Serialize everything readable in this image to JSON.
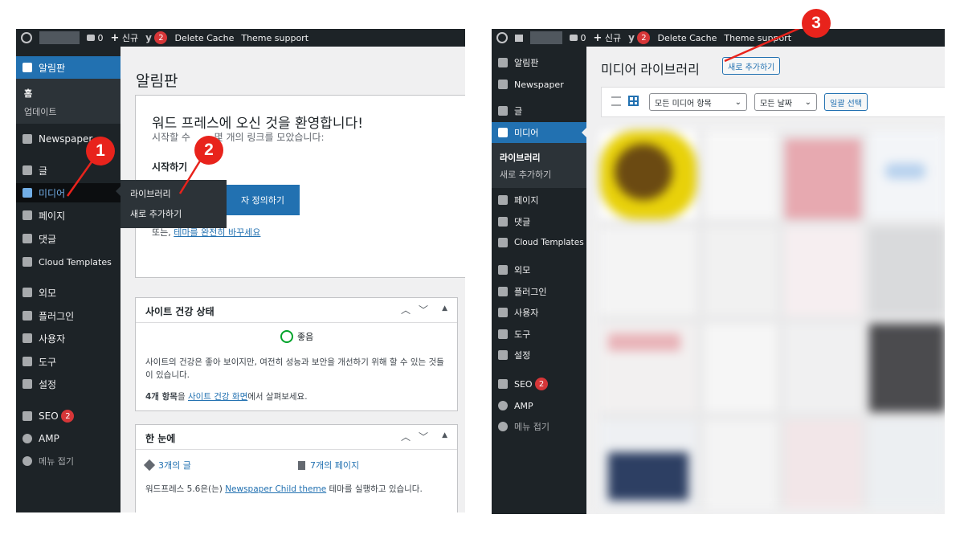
{
  "left": {
    "adminbar": {
      "comments_count": "0",
      "new_label": "신규",
      "seo_badge": "2",
      "delete_cache": "Delete Cache",
      "theme_support": "Theme support"
    },
    "sidebar": {
      "dashboard": "알림판",
      "home": "홈",
      "updates": "업데이트",
      "newspaper": "Newspaper",
      "posts": "글",
      "media": "미디어",
      "pages": "페이지",
      "comments": "댓글",
      "cloud": "Cloud Templates",
      "appearance": "외모",
      "plugins": "플러그인",
      "users": "사용자",
      "tools": "도구",
      "settings": "설정",
      "seo": "SEO",
      "seo_badge": "2",
      "amp": "AMP",
      "collapse": "메뉴 접기"
    },
    "flyout": {
      "library": "라이브러리",
      "add_new": "새로 추가하기"
    },
    "main": {
      "page_title": "알림판",
      "welcome_title": "워드 프레스에 오신 것을 환영합니다!",
      "welcome_sub_a": "시작할 수 ",
      "welcome_sub_b": " 몇 개의 링크를 모았습니다:",
      "getting_started": "시작하기",
      "customize_btn": "자 정의하기",
      "or_prefix": "또는, ",
      "or_link": "테마를 완전히 바꾸세요",
      "health_title": "사이트 건강 상태",
      "health_status": "좋음",
      "health_text": "사이트의 건강은 좋아 보이지만, 여전히 성능과 보안을 개선하기 위해 할 수 있는 것들이 있습니다.",
      "health_items_bold": "4개 항목",
      "health_items_mid": "을 ",
      "health_items_link": "사이트 건강 화면",
      "health_items_end": "에서 살펴보세요.",
      "glance_title": "한 눈에",
      "glance_posts": "3개의 글",
      "glance_pages": "7개의 페이지",
      "glance_wp_prefix": "워드프레스 5.6은(는) ",
      "glance_theme_link": "Newspaper Child theme",
      "glance_wp_suffix": " 테마를 실행하고 있습니다."
    },
    "annotations": {
      "n1": "1",
      "n2": "2"
    }
  },
  "right": {
    "adminbar": {
      "comments_count": "0",
      "new_label": "신규",
      "seo_badge": "2",
      "delete_cache": "Delete Cache",
      "theme_support": "Theme support"
    },
    "sidebar": {
      "dashboard": "알림판",
      "newspaper": "Newspaper",
      "posts": "글",
      "media": "미디어",
      "library": "라이브러리",
      "add_new": "새로 추가하기",
      "pages": "페이지",
      "comments": "댓글",
      "cloud": "Cloud Templates",
      "appearance": "외모",
      "plugins": "플러그인",
      "users": "사용자",
      "tools": "도구",
      "settings": "설정",
      "seo": "SEO",
      "seo_badge": "2",
      "amp": "AMP",
      "collapse": "메뉴 접기"
    },
    "main": {
      "page_title": "미디어 라이브러리",
      "add_new_btn": "새로 추가하기",
      "filter_media": "모든 미디어 항목",
      "filter_date": "모든 날짜",
      "bulk_select": "일괄 선택"
    },
    "annotations": {
      "n3": "3"
    }
  },
  "colors": {
    "admin_dark": "#1d2327",
    "accent_blue": "#2271b1",
    "annotation_red": "#e8231c",
    "badge_red": "#d63638"
  }
}
